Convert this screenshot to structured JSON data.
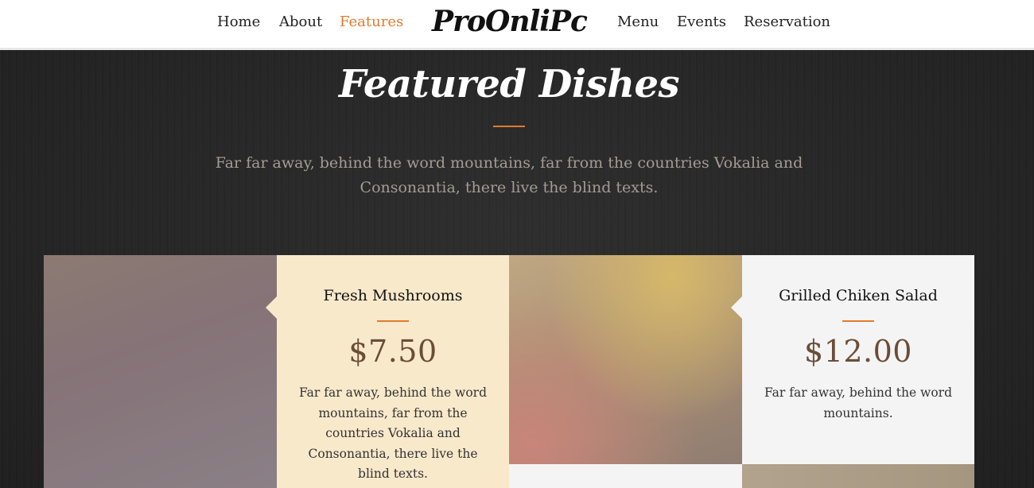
{
  "nav": {
    "left_links": [
      {
        "label": "Home"
      },
      {
        "label": "About"
      },
      {
        "label": "Features",
        "active": true
      }
    ],
    "brand": "ProOnliPc",
    "right_links": [
      {
        "label": "Menu"
      },
      {
        "label": "Events"
      },
      {
        "label": "Reservation"
      }
    ],
    "active_color": "#e27a2e"
  },
  "section": {
    "title": "Featured Dishes",
    "subtitle": "Far far away, behind the word mountains, far from the countries Vokalia and Consonantia, there live the blind texts."
  },
  "dishes": [
    {
      "name": "Fresh Mushrooms",
      "price": "$7.50",
      "description": "Far far away, behind the word mountains, far from the countries Vokalia and Consonantia, there live the blind texts.",
      "card_color": "#f9e9cb"
    },
    {
      "name": "Grilled Chiken Salad",
      "price": "$12.00",
      "description": "Far far away, behind the word mountains.",
      "card_color": "#f4f4f4"
    }
  ],
  "colors": {
    "accent": "#e27a2e",
    "price": "#6b4d36",
    "background": "#262626"
  }
}
